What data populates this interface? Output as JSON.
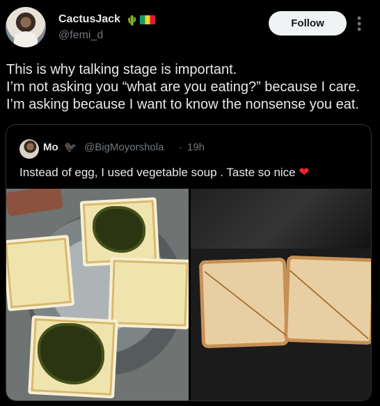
{
  "author": {
    "name": "CactusJack",
    "handle": "@femi_d"
  },
  "follow_label": "Follow",
  "tweet": {
    "lines": [
      "This is why talking stage is important.",
      "I’m not asking you “what are you eating?” because I care.",
      "I’m asking because I want to know the nonsense you eat."
    ]
  },
  "quoted": {
    "name": "Mo",
    "handle": "@BigMoyorshola",
    "separator": "·",
    "time": "19h",
    "text": "Instead of egg, I used vegetable soup . Taste so nice"
  },
  "icons": {
    "author_badge": "cactus-flag-icons",
    "more": "more-options-icon",
    "quoted_badge": "bird-icon",
    "heart": "heart-icon"
  },
  "colors": {
    "background": "#000000",
    "text": "#e7e9ea",
    "muted": "#71767b",
    "follow_button": "#eff3f4",
    "heart": "#f4212e"
  }
}
